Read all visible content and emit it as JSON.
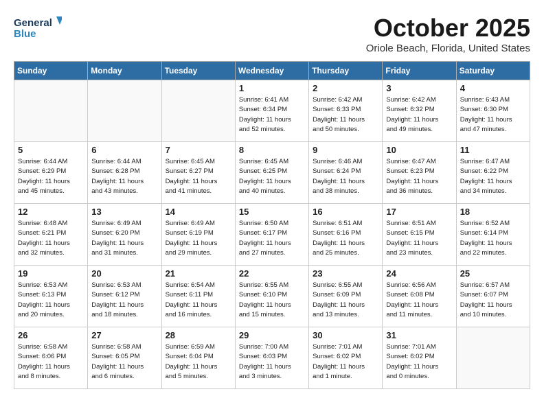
{
  "header": {
    "logo_line1": "General",
    "logo_line2": "Blue",
    "month_title": "October 2025",
    "location": "Oriole Beach, Florida, United States"
  },
  "weekdays": [
    "Sunday",
    "Monday",
    "Tuesday",
    "Wednesday",
    "Thursday",
    "Friday",
    "Saturday"
  ],
  "weeks": [
    [
      {
        "day": "",
        "info": ""
      },
      {
        "day": "",
        "info": ""
      },
      {
        "day": "",
        "info": ""
      },
      {
        "day": "1",
        "info": "Sunrise: 6:41 AM\nSunset: 6:34 PM\nDaylight: 11 hours\nand 52 minutes."
      },
      {
        "day": "2",
        "info": "Sunrise: 6:42 AM\nSunset: 6:33 PM\nDaylight: 11 hours\nand 50 minutes."
      },
      {
        "day": "3",
        "info": "Sunrise: 6:42 AM\nSunset: 6:32 PM\nDaylight: 11 hours\nand 49 minutes."
      },
      {
        "day": "4",
        "info": "Sunrise: 6:43 AM\nSunset: 6:30 PM\nDaylight: 11 hours\nand 47 minutes."
      }
    ],
    [
      {
        "day": "5",
        "info": "Sunrise: 6:44 AM\nSunset: 6:29 PM\nDaylight: 11 hours\nand 45 minutes."
      },
      {
        "day": "6",
        "info": "Sunrise: 6:44 AM\nSunset: 6:28 PM\nDaylight: 11 hours\nand 43 minutes."
      },
      {
        "day": "7",
        "info": "Sunrise: 6:45 AM\nSunset: 6:27 PM\nDaylight: 11 hours\nand 41 minutes."
      },
      {
        "day": "8",
        "info": "Sunrise: 6:45 AM\nSunset: 6:25 PM\nDaylight: 11 hours\nand 40 minutes."
      },
      {
        "day": "9",
        "info": "Sunrise: 6:46 AM\nSunset: 6:24 PM\nDaylight: 11 hours\nand 38 minutes."
      },
      {
        "day": "10",
        "info": "Sunrise: 6:47 AM\nSunset: 6:23 PM\nDaylight: 11 hours\nand 36 minutes."
      },
      {
        "day": "11",
        "info": "Sunrise: 6:47 AM\nSunset: 6:22 PM\nDaylight: 11 hours\nand 34 minutes."
      }
    ],
    [
      {
        "day": "12",
        "info": "Sunrise: 6:48 AM\nSunset: 6:21 PM\nDaylight: 11 hours\nand 32 minutes."
      },
      {
        "day": "13",
        "info": "Sunrise: 6:49 AM\nSunset: 6:20 PM\nDaylight: 11 hours\nand 31 minutes."
      },
      {
        "day": "14",
        "info": "Sunrise: 6:49 AM\nSunset: 6:19 PM\nDaylight: 11 hours\nand 29 minutes."
      },
      {
        "day": "15",
        "info": "Sunrise: 6:50 AM\nSunset: 6:17 PM\nDaylight: 11 hours\nand 27 minutes."
      },
      {
        "day": "16",
        "info": "Sunrise: 6:51 AM\nSunset: 6:16 PM\nDaylight: 11 hours\nand 25 minutes."
      },
      {
        "day": "17",
        "info": "Sunrise: 6:51 AM\nSunset: 6:15 PM\nDaylight: 11 hours\nand 23 minutes."
      },
      {
        "day": "18",
        "info": "Sunrise: 6:52 AM\nSunset: 6:14 PM\nDaylight: 11 hours\nand 22 minutes."
      }
    ],
    [
      {
        "day": "19",
        "info": "Sunrise: 6:53 AM\nSunset: 6:13 PM\nDaylight: 11 hours\nand 20 minutes."
      },
      {
        "day": "20",
        "info": "Sunrise: 6:53 AM\nSunset: 6:12 PM\nDaylight: 11 hours\nand 18 minutes."
      },
      {
        "day": "21",
        "info": "Sunrise: 6:54 AM\nSunset: 6:11 PM\nDaylight: 11 hours\nand 16 minutes."
      },
      {
        "day": "22",
        "info": "Sunrise: 6:55 AM\nSunset: 6:10 PM\nDaylight: 11 hours\nand 15 minutes."
      },
      {
        "day": "23",
        "info": "Sunrise: 6:55 AM\nSunset: 6:09 PM\nDaylight: 11 hours\nand 13 minutes."
      },
      {
        "day": "24",
        "info": "Sunrise: 6:56 AM\nSunset: 6:08 PM\nDaylight: 11 hours\nand 11 minutes."
      },
      {
        "day": "25",
        "info": "Sunrise: 6:57 AM\nSunset: 6:07 PM\nDaylight: 11 hours\nand 10 minutes."
      }
    ],
    [
      {
        "day": "26",
        "info": "Sunrise: 6:58 AM\nSunset: 6:06 PM\nDaylight: 11 hours\nand 8 minutes."
      },
      {
        "day": "27",
        "info": "Sunrise: 6:58 AM\nSunset: 6:05 PM\nDaylight: 11 hours\nand 6 minutes."
      },
      {
        "day": "28",
        "info": "Sunrise: 6:59 AM\nSunset: 6:04 PM\nDaylight: 11 hours\nand 5 minutes."
      },
      {
        "day": "29",
        "info": "Sunrise: 7:00 AM\nSunset: 6:03 PM\nDaylight: 11 hours\nand 3 minutes."
      },
      {
        "day": "30",
        "info": "Sunrise: 7:01 AM\nSunset: 6:02 PM\nDaylight: 11 hours\nand 1 minute."
      },
      {
        "day": "31",
        "info": "Sunrise: 7:01 AM\nSunset: 6:02 PM\nDaylight: 11 hours\nand 0 minutes."
      },
      {
        "day": "",
        "info": ""
      }
    ]
  ]
}
